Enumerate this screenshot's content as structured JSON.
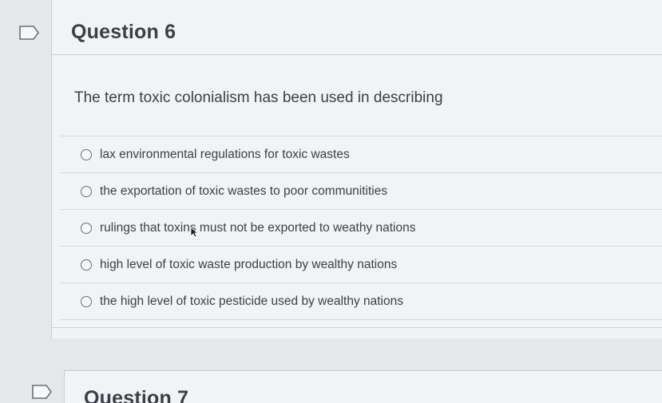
{
  "questions": [
    {
      "title": "Question 6",
      "prompt": "The term toxic colonialism has been used in describing",
      "options": [
        "lax environmental regulations for toxic wastes",
        "the exportation of toxic wastes to poor communitities",
        "rulings that toxins must not be exported to weathy nations",
        "high level of toxic waste production by wealthy nations",
        "the high level of toxic pesticide used by wealthy nations"
      ]
    },
    {
      "title": "Question 7"
    }
  ],
  "icons": {
    "flag": "flag-outline-icon",
    "radio": "radio-unselected-icon",
    "cursor": "mouse-pointer-icon"
  },
  "colors": {
    "background": "#e6e7ea",
    "card": "#f2f3f5",
    "text": "#3d4047",
    "divider": "#d6d9dd"
  }
}
